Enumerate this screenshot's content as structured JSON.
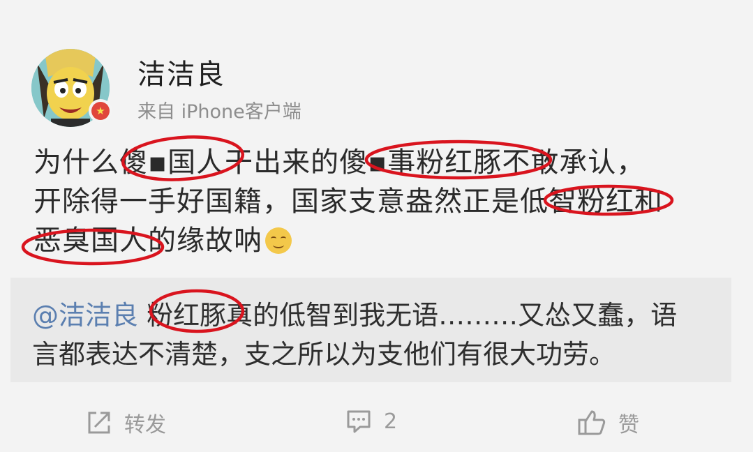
{
  "post": {
    "username": "洁洁良",
    "source": "来自 iPhone客户端",
    "lines": [
      "为什么傻▪国人干出来的傻▪事粉红豚不敢承认，",
      "开除得一手好国籍，国家支意盎然正是低智粉红和",
      "恶臭国人的缘故呐"
    ]
  },
  "repost": {
    "mention": "@洁洁良",
    "line1_rest": "粉红豚真的低智到我无语………又怂又蠢，语",
    "line2": "言都表达不清楚，支之所以为支他们有很大功劳。"
  },
  "actions": {
    "repost_label": "转发",
    "comment_count": "2",
    "like_label": "赞"
  },
  "icons": {
    "repost": "share-icon",
    "comment": "comment-icon",
    "like": "thumbs-up-icon",
    "badge": "vip-badge-icon"
  },
  "colors": {
    "background": "#f3f3f3",
    "mention": "#5b7fb0",
    "highlight_circle": "#d9141e",
    "action_gray": "#9a9a9a"
  }
}
